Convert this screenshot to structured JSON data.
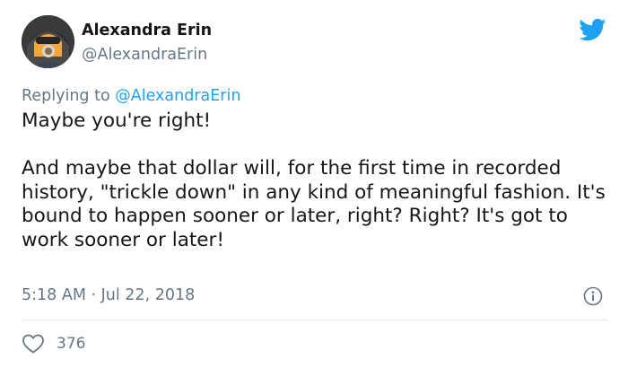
{
  "author": {
    "display_name": "Alexandra Erin",
    "handle": "@AlexandraErin"
  },
  "reply": {
    "prefix": "Replying to ",
    "mention": "@AlexandraErin"
  },
  "tweet": {
    "paragraph_1": "Maybe you're right!",
    "paragraph_2": "And maybe that dollar will, for the first time in recorded history, \"trickle down\" in any kind of meaningful fashion. It's bound to happen sooner or later, right? Right? It's got to work sooner or later!"
  },
  "meta": {
    "timestamp": "5:18 AM · Jul 22, 2018"
  },
  "actions": {
    "like_count": "376"
  },
  "icons": {
    "brand": "twitter-bird-icon",
    "info": "info-icon",
    "like": "heart-icon"
  },
  "colors": {
    "brand_blue": "#1da1f2",
    "secondary_text": "#657786",
    "primary_text": "#14171a",
    "divider": "#e1e8ed"
  }
}
